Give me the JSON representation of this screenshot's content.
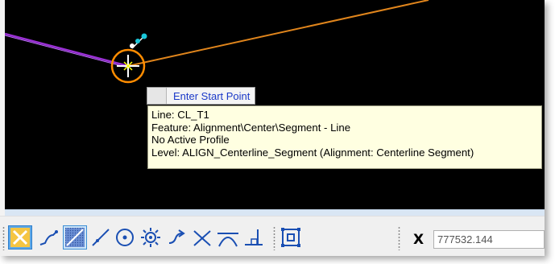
{
  "canvas": {
    "prompt": {
      "message": "Enter Start Point"
    },
    "tooltip": {
      "lines": [
        "Line: CL_T1",
        "Feature: Alignment\\Center\\Segment - Line",
        "No Active Profile",
        "Level: ALIGN_Centerline_Segment (Alignment: Centerline Segment)"
      ]
    },
    "colors": {
      "background": "#000000",
      "selected_line": "#9b30d6",
      "alignment_line": "#e0851c",
      "snap_marker": "#ff8c00",
      "handle": "#19c6d9",
      "prompt_text": "#1b39c8",
      "tooltip_bg": "#ffffe1"
    }
  },
  "toolbar": {
    "tools": [
      {
        "name": "ortho-snap-icon",
        "active": true
      },
      {
        "name": "keypoint-curve-icon",
        "active": false
      },
      {
        "name": "nearest-snap-icon",
        "active": true
      },
      {
        "name": "line-snap-icon",
        "active": false
      },
      {
        "name": "center-snap-icon",
        "active": false
      },
      {
        "name": "origin-snap-icon",
        "active": false
      },
      {
        "name": "tangent-snap-icon",
        "active": false
      },
      {
        "name": "intersection-snap-icon",
        "active": false
      },
      {
        "name": "tangent-arc-icon",
        "active": false
      },
      {
        "name": "perpendicular-snap-icon",
        "active": false
      },
      {
        "name": "bounding-box-snap-icon",
        "active": false
      }
    ],
    "x_coordinate": {
      "label": "X",
      "value": "777532.144"
    }
  }
}
